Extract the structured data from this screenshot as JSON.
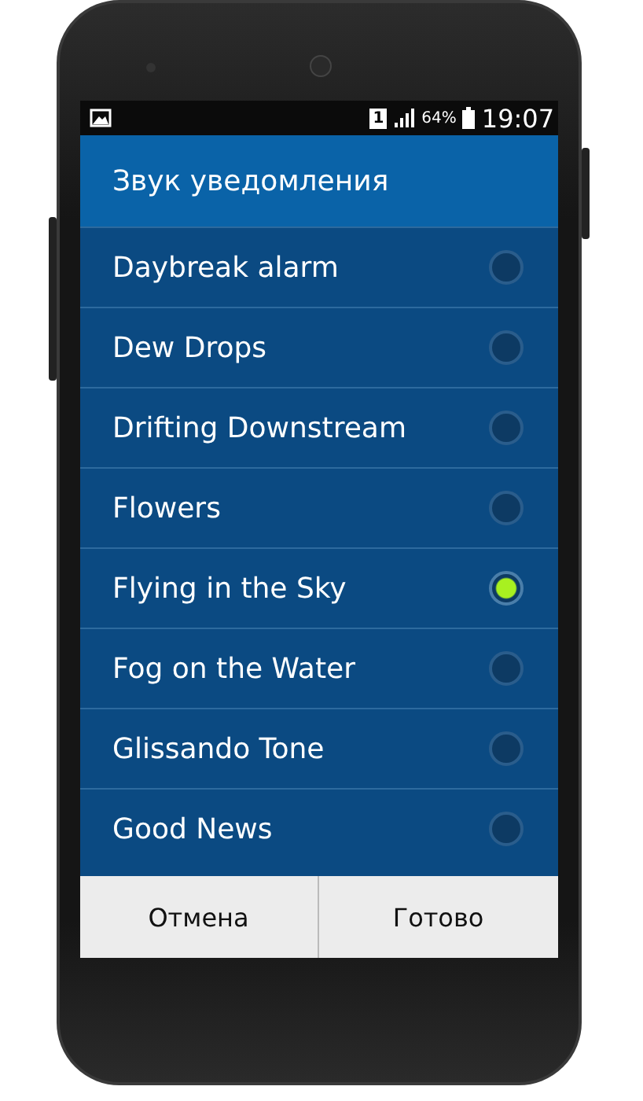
{
  "status_bar": {
    "sim": "1",
    "battery_percent": "64%",
    "time": "19:07"
  },
  "dialog": {
    "title": "Звук уведомления",
    "options": [
      {
        "label": "Daybreak alarm",
        "selected": false
      },
      {
        "label": "Dew Drops",
        "selected": false
      },
      {
        "label": "Drifting Downstream",
        "selected": false
      },
      {
        "label": "Flowers",
        "selected": false
      },
      {
        "label": "Flying in the Sky",
        "selected": true
      },
      {
        "label": "Fog on the Water",
        "selected": false
      },
      {
        "label": "Glissando Tone",
        "selected": false
      },
      {
        "label": "Good News",
        "selected": false
      }
    ],
    "buttons": [
      "Отмена",
      "Готово"
    ]
  }
}
